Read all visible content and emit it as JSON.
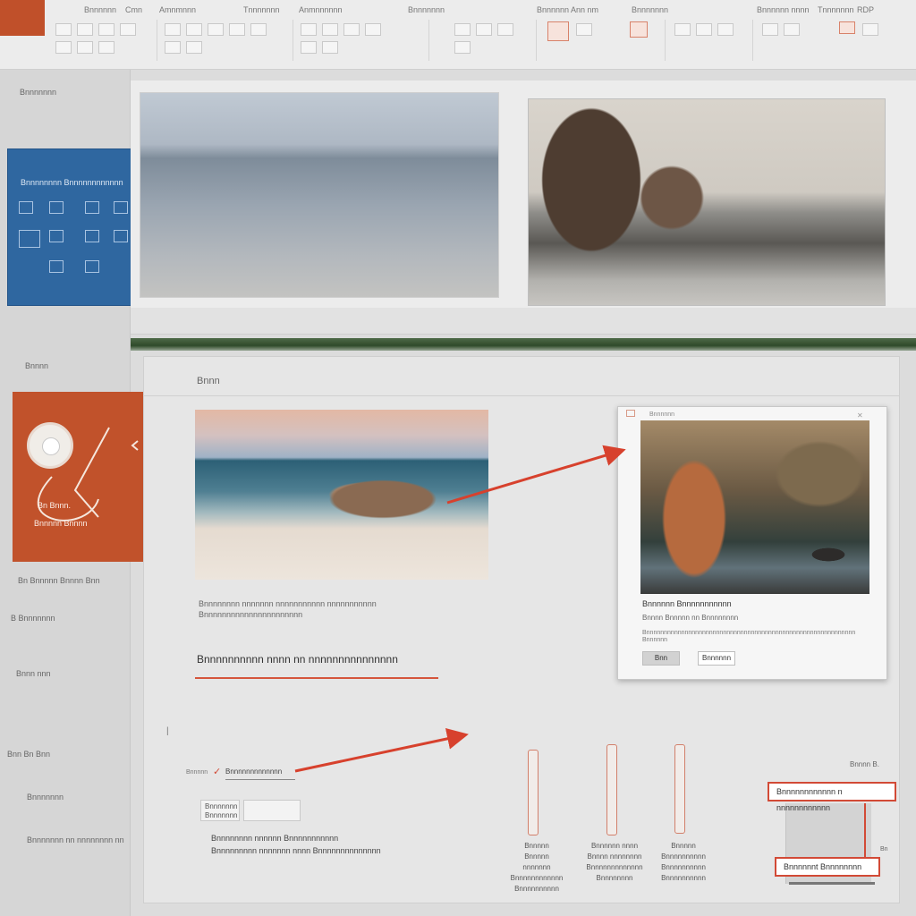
{
  "ribbon": {
    "app_tile_label": "",
    "tabs": [
      "Bnnnnnn",
      "Cmn",
      "Amnmnnn",
      "Tnnnnnnn",
      "Anmnnnnnn",
      "Bnnnnnnn",
      "Bnnnnnn Ann nm",
      "Bnnnnnnn",
      "Bnnnnnn nnnn",
      "Tnnnnnnn",
      "RDP"
    ]
  },
  "left_pane": {
    "labels": [
      "Bnnnnnnn",
      "Bnnnn",
      "Bnnn nnn",
      "Bn Bnnnnn Bnnnn Bnn",
      "B Bnnnnnnn",
      "Bnn Bn Bnn",
      "Bnnnnnnn",
      "Bnnnnnnn nn nnnnnnnn nn"
    ],
    "blue_thumb_title": "Bnnnnnnnn Bnnnnnnnnnnnn",
    "orange_thumb_text": [
      "Bn Bnnn.",
      "Bnnnnn Bnnnn"
    ]
  },
  "slide": {
    "header": "Bnnn",
    "beach_caption_1": "Bnnnnnnnn nnnnnnn nnnnnnnnnnn nnnnnnnnnnn",
    "beach_caption_2": "Bnnnnnnnnnnnnnnnnnnnnnn",
    "section_title": "Bnnnnnnnnnn nnnn nn nnnnnnnnnnnnnnn",
    "dialog": {
      "title_small": "Bnnnnnn",
      "heading": "Bnnnnnn Bnnnnnnnnnnn",
      "sub": "Bnnnn Bnnnnn nn Bnnnnnnnn",
      "body": "Bnnnnnnnnnnnnnnnnnnnnnnnnnnnnnnnnnnnnnnnnnnnnnnnnnnnnnnnnnnnn",
      "body2": "Bnnnnnn",
      "btn_ok": "Bnn",
      "btn_cancel": "Bnnnnnn"
    },
    "tag_label": "Bnnnnn",
    "tag_box": "Bnnnnnnnnnnnnn",
    "small_box_1": "Bnnnnnnn\nBnnnnnnn",
    "small_box_2": "",
    "lower_text_1": "Bnnnnnnnn nnnnnn Bnnnnnnnnnnn",
    "lower_text_2": "Bnnnnnnnnn nnnnnnn nnnn Bnnnnnnnnnnnnnn",
    "slider_labels": [
      [
        "Bnnnnn",
        "Bnnnnn nnnnnnn",
        "Bnnnnnnnnnnnn",
        "Bnnnnnnnnnn"
      ],
      [
        "Bnnnnnn nnnn",
        "Bnnnn nnnnnnnn",
        "Bnnnnnnnnnnnnn",
        "Bnnnnnnnn"
      ],
      [
        "Bnnnnn",
        "Bnnnnnnnnnn",
        "Bnnnnnnnnnn",
        "Bnnnnnnnnnn"
      ]
    ],
    "right_label_top": "Bnnnn B.",
    "annotation_top": "Bnnnnnnnnnnnn n nnnnnnnnnnnn",
    "annotation_bottom": "Bnnnnnnt Bnnnnnnnn",
    "side_marker": "Bn"
  },
  "colors": {
    "accent_orange": "#c1522b",
    "accent_blue": "#2f67a0",
    "annotation_red": "#d24a36"
  }
}
